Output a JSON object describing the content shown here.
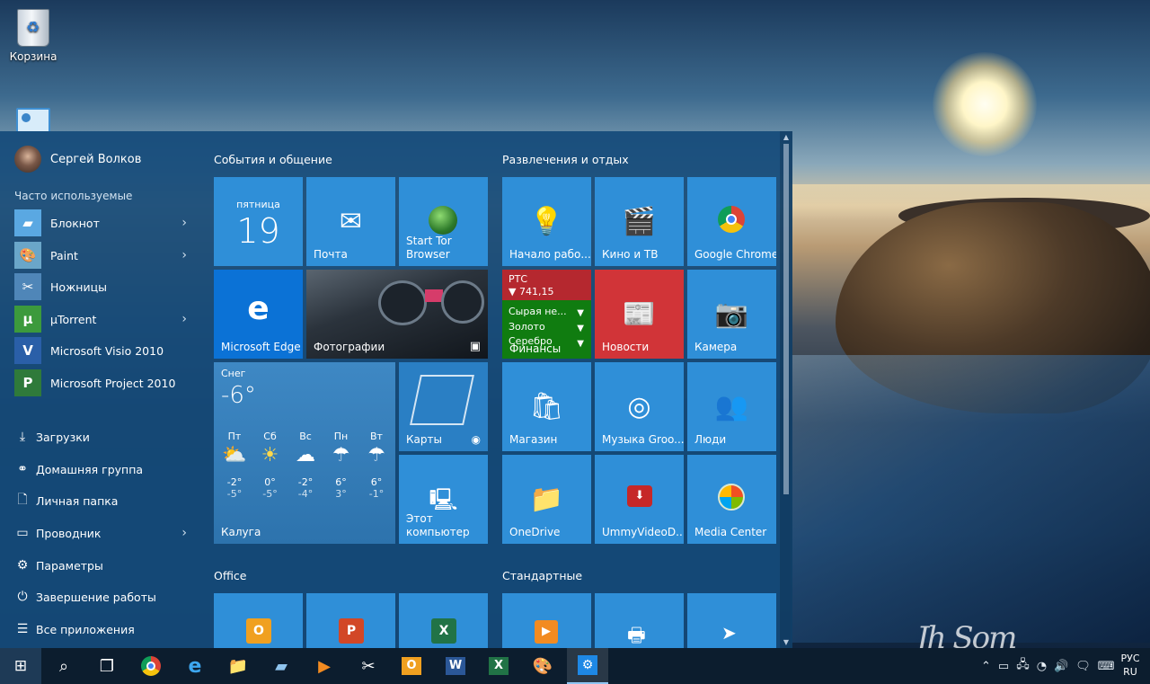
{
  "desktop": {
    "recycle_bin_label": "Корзина",
    "signature": "Jh Som"
  },
  "start_menu": {
    "user_name": "Сергей Волков",
    "frequent_header": "Часто используемые",
    "frequent_apps": [
      {
        "label": "Блокнот",
        "icon": "notepad-icon",
        "has_arrow": true
      },
      {
        "label": "Paint",
        "icon": "paint-icon",
        "has_arrow": true
      },
      {
        "label": "Ножницы",
        "icon": "scissors-icon",
        "has_arrow": false
      },
      {
        "label": "µTorrent",
        "icon": "utorrent-icon",
        "has_arrow": true
      },
      {
        "label": "Microsoft Visio 2010",
        "icon": "visio-icon",
        "has_arrow": false
      },
      {
        "label": "Microsoft Project 2010",
        "icon": "project-icon",
        "has_arrow": false
      }
    ],
    "system_items": [
      {
        "label": "Загрузки",
        "icon": "download-icon"
      },
      {
        "label": "Домашняя группа",
        "icon": "homegroup-icon"
      },
      {
        "label": "Личная папка",
        "icon": "user-folder-icon"
      },
      {
        "label": "Проводник",
        "icon": "explorer-icon",
        "has_arrow": true
      },
      {
        "label": "Параметры",
        "icon": "gear-icon"
      },
      {
        "label": "Завершение работы",
        "icon": "power-icon"
      },
      {
        "label": "Все приложения",
        "icon": "all-apps-icon"
      }
    ],
    "groups": {
      "social": "События и общение",
      "entertainment": "Развлечения и отдых",
      "office": "Office",
      "standard": "Стандартные"
    },
    "tiles": {
      "calendar": {
        "day": "пятница",
        "date": "19"
      },
      "mail": "Почта",
      "tor": "Start Tor Browser",
      "edge": "Microsoft Edge",
      "photos": "Фотографии",
      "weather": {
        "condition": "Снег",
        "temp": "-6°",
        "city": "Калуга",
        "days": [
          {
            "day": "Пт",
            "icon": "partly-sunny-icon",
            "hi": "-2°",
            "lo": "-5°"
          },
          {
            "day": "Сб",
            "icon": "sunny-icon",
            "hi": "0°",
            "lo": "-5°"
          },
          {
            "day": "Вс",
            "icon": "cloudy-icon",
            "hi": "-2°",
            "lo": "-4°"
          },
          {
            "day": "Пн",
            "icon": "rain-snow-icon",
            "hi": "6°",
            "lo": "3°"
          },
          {
            "day": "Вт",
            "icon": "rain-snow-icon",
            "hi": "6°",
            "lo": "-1°"
          }
        ]
      },
      "maps": "Карты",
      "computer": "Этот компьютер",
      "getstarted": "Начало рабо...",
      "movies": "Кино и ТВ",
      "chrome": "Google Chrome",
      "finance": {
        "index_name": "РТС",
        "index_value": "▼ 741,15",
        "rows": [
          "Сырая не...",
          "Золото",
          "Серебро"
        ],
        "label": "Финансы"
      },
      "news": "Новости",
      "camera": "Камера",
      "store": "Магазин",
      "music": "Музыка Groo...",
      "people": "Люди",
      "onedrive": "OneDrive",
      "ummy": "UmmyVideoD...",
      "mediacenter": "Media Center"
    }
  },
  "taskbar": {
    "apps": [
      "windows-logo-icon",
      "search-icon",
      "task-view-icon",
      "chrome-icon",
      "ie-icon",
      "explorer-icon",
      "notepad-icon",
      "media-icon",
      "scissors-icon",
      "outlook-icon",
      "word-icon",
      "excel-icon",
      "paint-icon",
      "settings-icon"
    ],
    "lang_line1": "РУС",
    "lang_line2": "RU"
  },
  "colors": {
    "tile_blue": "#2f8fd8",
    "news_red": "#d13438",
    "finance_green": "#107c10",
    "finance_red_header": "#b5282f",
    "start_bg": "#144a7a",
    "taskbar_bg": "#0c1d2e"
  }
}
